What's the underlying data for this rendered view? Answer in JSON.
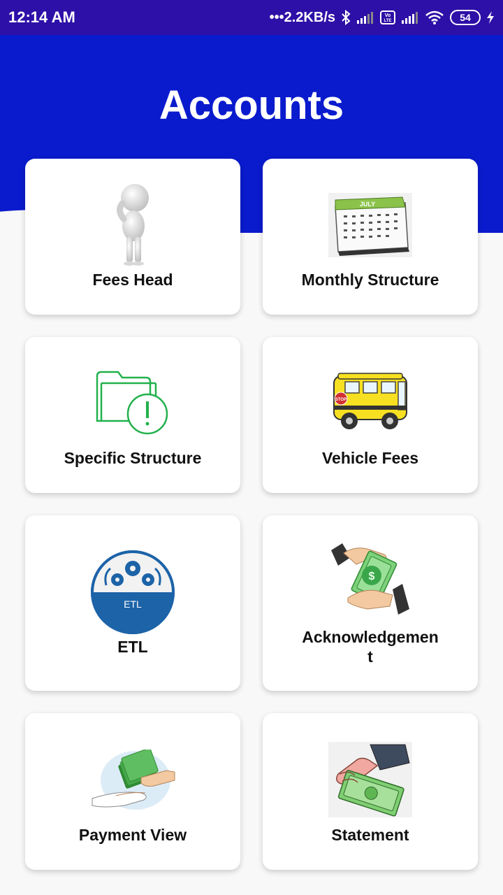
{
  "status_bar": {
    "time": "12:14 AM",
    "network_speed": "•••2.2KB/s",
    "icons": [
      "bluetooth-icon",
      "signal-icon",
      "volte-icon",
      "signal-icon",
      "wifi-icon"
    ],
    "battery": "54",
    "volte_label": "Vo LTE"
  },
  "header": {
    "title": "Accounts",
    "color": "#0a1bcd"
  },
  "cards": [
    {
      "label": "Fees Head",
      "icon": "thinking-person-icon"
    },
    {
      "label": "Monthly Structure",
      "icon": "calendar-icon",
      "icon_text": "JULY"
    },
    {
      "label": "Specific Structure",
      "icon": "folder-alert-icon"
    },
    {
      "label": "Vehicle Fees",
      "icon": "school-bus-icon",
      "icon_text": "STOP"
    },
    {
      "label": "ETL",
      "icon": "etl-gears-icon",
      "icon_text": "ETL"
    },
    {
      "label": "Acknowledgemen\nt",
      "icon": "money-exchange-icon"
    },
    {
      "label": "Payment View",
      "icon": "payment-hands-icon"
    },
    {
      "label": "Statement",
      "icon": "money-hand-icon"
    }
  ],
  "colors": {
    "status_bar": "#2d10a7",
    "header": "#0a1bcd",
    "background": "#f8f8f8",
    "card": "#ffffff"
  }
}
